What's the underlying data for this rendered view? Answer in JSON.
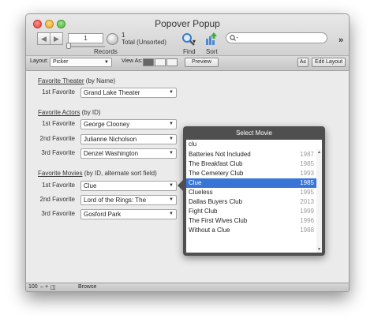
{
  "window": {
    "title": "Popover Popup"
  },
  "toolbar": {
    "record_number": "1",
    "records_count": "1",
    "records_status": "Total (Unsorted)",
    "records_label": "Records",
    "find_label": "Find",
    "sort_label": "Sort",
    "search_placeholder": ""
  },
  "layoutbar": {
    "layout_label": "Layout:",
    "layout_value": "Picker",
    "view_as_label": "View As:",
    "preview_label": "Preview",
    "font_button": "A≤",
    "edit_layout_label": "Edit Layout"
  },
  "sections": {
    "theater": {
      "title": "Favorite Theater",
      "suffix": "(by Name)",
      "rows": [
        {
          "label": "1st Favorite",
          "value": "Grand Lake Theater"
        }
      ]
    },
    "actors": {
      "title": "Favorite Actors",
      "suffix": "(by ID)",
      "rows": [
        {
          "label": "1st Favorite",
          "value": "George Clooney"
        },
        {
          "label": "2nd Favorite",
          "value": "Julianne Nicholson"
        },
        {
          "label": "3rd Favorite",
          "value": "Denzel Washington"
        }
      ]
    },
    "movies": {
      "title": "Favorite Movies",
      "suffix": "(by ID, alternate sort field)",
      "rows": [
        {
          "label": "1st Favorite",
          "value": "Clue"
        },
        {
          "label": "2nd Favorite",
          "value": "Lord of the Rings: The"
        },
        {
          "label": "3rd Favorite",
          "value": "Gosford Park"
        }
      ]
    }
  },
  "popover": {
    "title": "Select Movie",
    "query": "clu",
    "items": [
      {
        "name": "Batteries Not Included",
        "year": "1987"
      },
      {
        "name": "The Breakfast Club",
        "year": "1985"
      },
      {
        "name": "The Cemetery Club",
        "year": "1993"
      },
      {
        "name": "Clue",
        "year": "1985",
        "selected": true
      },
      {
        "name": "Clueless",
        "year": "1995"
      },
      {
        "name": "Dallas Buyers Club",
        "year": "2013"
      },
      {
        "name": "Fight Club",
        "year": "1999"
      },
      {
        "name": "The First Wives Club",
        "year": "1996"
      },
      {
        "name": "Without a Clue",
        "year": "1988"
      }
    ]
  },
  "statusbar": {
    "zoom": "100",
    "mode": "Browse"
  },
  "colors": {
    "selection": "#3875d7",
    "popover_bg": "#4f4f4f",
    "window_bg": "#ebebeb"
  }
}
